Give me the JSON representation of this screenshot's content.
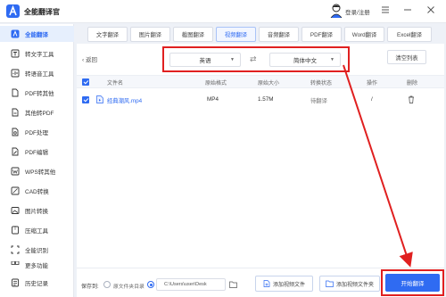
{
  "app": {
    "title": "全能翻译官",
    "login_text": "登录/注册"
  },
  "sidebar": {
    "items": [
      {
        "label": "全能翻译",
        "icon": "translate-icon",
        "active": true
      },
      {
        "label": "转文字工具",
        "icon": "text-convert-icon"
      },
      {
        "label": "转语音工具",
        "icon": "speech-icon"
      },
      {
        "label": "PDF转其他",
        "icon": "pdf-convert-icon"
      },
      {
        "label": "其他转PDF",
        "icon": "to-pdf-icon"
      },
      {
        "label": "PDF处理",
        "icon": "pdf-process-icon"
      },
      {
        "label": "PDF编辑",
        "icon": "pdf-edit-icon"
      },
      {
        "label": "WPS转其他",
        "icon": "wps-icon"
      },
      {
        "label": "CAD转换",
        "icon": "cad-icon"
      },
      {
        "label": "图片转换",
        "icon": "image-convert-icon"
      },
      {
        "label": "压缩工具",
        "icon": "compress-icon"
      },
      {
        "label": "全能识别",
        "icon": "recognize-icon"
      },
      {
        "label": "更多功能",
        "icon": "more-icon"
      },
      {
        "label": "历史记录",
        "icon": "history-icon"
      }
    ]
  },
  "tabs": [
    "文字翻译",
    "图片翻译",
    "截图翻译",
    "视频翻译",
    "音频翻译",
    "PDF翻译",
    "Word翻译",
    "Excel翻译"
  ],
  "active_tab": "视频翻译",
  "toolbar": {
    "back_label": "返回",
    "source_lang": "英语",
    "target_lang": "简体中文",
    "swap_symbol": "⇄",
    "clear_label": "清空列表"
  },
  "table": {
    "headers": {
      "name": "文件名",
      "format": "原始格式",
      "size": "原始大小",
      "status": "转换状态",
      "action": "操作",
      "delete": "删除"
    },
    "rows": [
      {
        "name": "经典潮风.mp4",
        "format": "MP4",
        "size": "1.57M",
        "status": "待翻译",
        "action": "/"
      }
    ]
  },
  "bottom": {
    "save_label": "保存到:",
    "radio_original": "原文件夹目录",
    "path": "C:\\Users\\user\\Desk",
    "add_file": "添加视频文件",
    "add_folder": "添加视频文件夹",
    "start": "开始翻译"
  },
  "colors": {
    "accent": "#2f6bf2",
    "highlight": "#e02020"
  }
}
